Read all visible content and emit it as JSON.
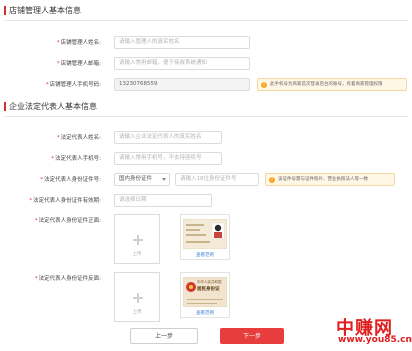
{
  "store_section": {
    "title": "店铺管理人基本信息",
    "fields": {
      "name": {
        "label": "店铺管理人姓名:",
        "placeholder": "请输入管理人的真实姓名"
      },
      "email": {
        "label": "店铺管理人邮箱:",
        "placeholder": "请输入常用邮箱，便于接收系统通知"
      },
      "phone": {
        "label": "店铺管理人手机号码:",
        "value": "13230768559",
        "tip": "此手机号为商家首次登录后台的账号，有着商家管理权限"
      }
    }
  },
  "legal_section": {
    "title": "企业法定代表人基本信息",
    "fields": {
      "name": {
        "label": "法定代表人姓名:",
        "placeholder": "请输入企业法定代表人的真实姓名"
      },
      "phone": {
        "label": "法定代表人手机号:",
        "placeholder": "请输入常用手机号，不支持座机号"
      },
      "id_number": {
        "label": "法定代表人身份证件号:",
        "id_type": "国内身份证件",
        "placeholder": "请输入18位身份证件号",
        "tip": "该证件号需与证件照片、营业执照法人等一致"
      },
      "id_validity": {
        "label": "法定代表人身份证件有效期:",
        "placeholder": "请选择日期"
      },
      "id_front": {
        "label": "法定代表人身份证件正面:",
        "upload_text": "上传",
        "sample_link": "查看范例"
      },
      "id_back": {
        "label": "法定代表人身份证件反面:",
        "upload_text": "上传",
        "sample_link": "查看范例",
        "card_title": "中华人民共和国",
        "card_subtitle": "居民身份证"
      }
    }
  },
  "buttons": {
    "prev": "上一步",
    "next": "下一步"
  },
  "watermark": {
    "brand": "中赚网",
    "url": "www.you85.cn"
  },
  "colors": {
    "accent": "#e02b2b",
    "tip_bg": "#fff7e6",
    "next_button": "#e73d3d"
  }
}
